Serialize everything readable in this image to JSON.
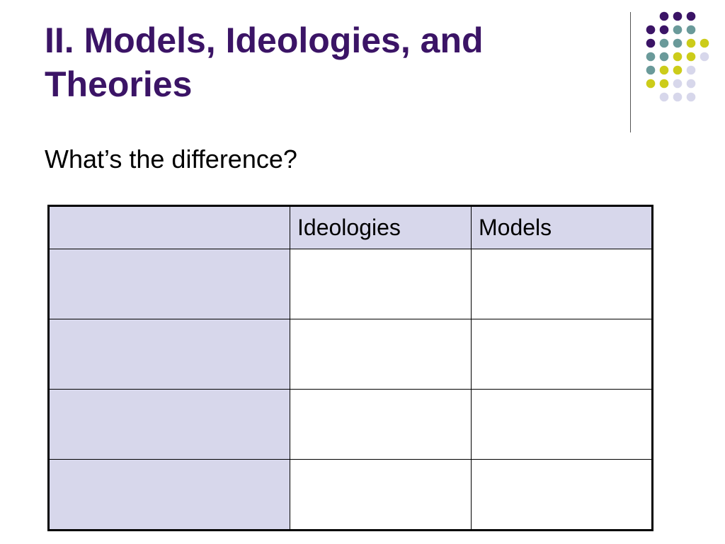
{
  "slide": {
    "title_lines": [
      "II. Models, Ideologies, and",
      "Theories"
    ],
    "subtitle": "What’s the difference?",
    "colors": {
      "title": "#3b1466",
      "header_fill": "#d7d7eb",
      "dot_purple": "#3b1466",
      "dot_teal": "#6a9a9a",
      "dot_yellow": "#cccc1a",
      "dot_lavender": "#d7d7eb"
    }
  },
  "table": {
    "headers": [
      "",
      "Ideologies",
      "Models"
    ],
    "rows": [
      [
        "",
        "",
        ""
      ],
      [
        "",
        "",
        ""
      ],
      [
        "",
        "",
        ""
      ],
      [
        "",
        "",
        ""
      ]
    ]
  },
  "decoration": {
    "dot_grid": [
      [
        "purple",
        "purple",
        "purple"
      ],
      [
        "purple",
        "purple",
        "teal",
        "teal"
      ],
      [
        "purple",
        "teal",
        "teal",
        "yellow",
        "yellow"
      ],
      [
        "teal",
        "teal",
        "yellow",
        "yellow",
        "lavender"
      ],
      [
        "teal",
        "yellow",
        "yellow",
        "lavender"
      ],
      [
        "yellow",
        "yellow",
        "lavender",
        "lavender"
      ],
      [
        "lavender",
        "lavender",
        "lavender"
      ]
    ]
  }
}
